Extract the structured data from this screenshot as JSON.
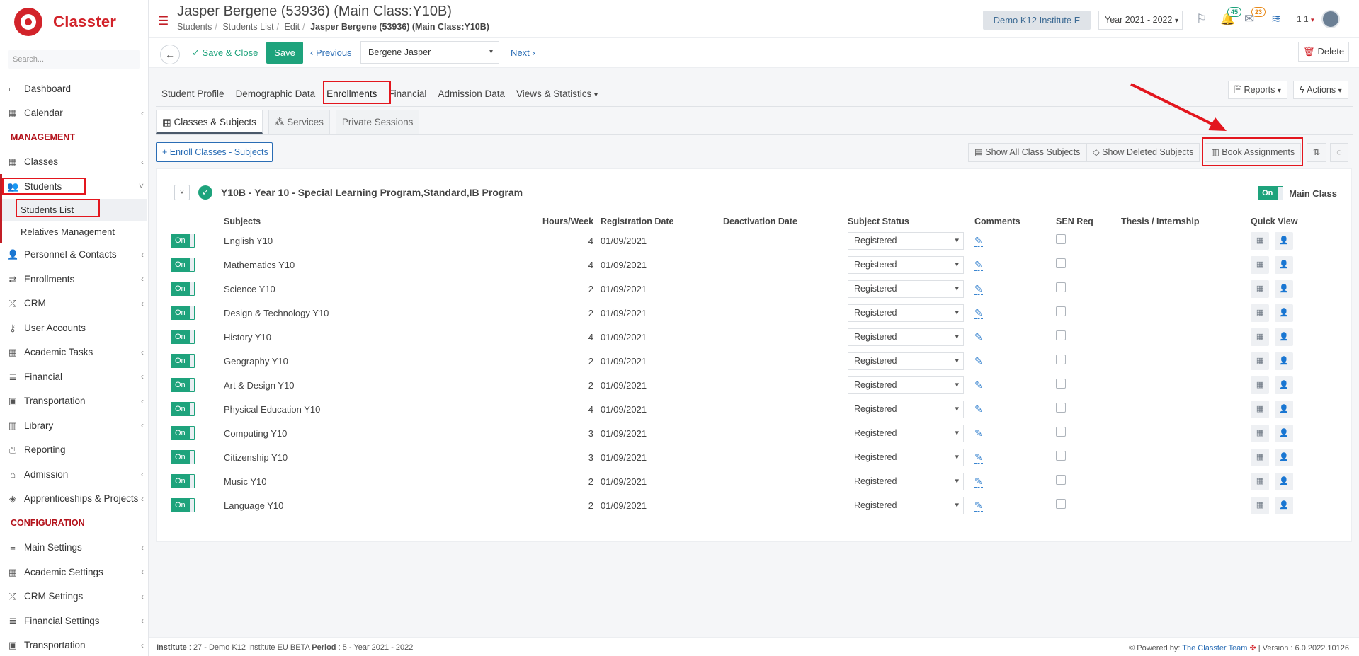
{
  "brand": {
    "name": "Classter",
    "red": "#d2232a",
    "green": "#1ea37c"
  },
  "sidebar": {
    "search_placeholder": "Search...",
    "items_top": [
      {
        "label": "Dashboard",
        "icon": "monitor-icon"
      },
      {
        "label": "Calendar",
        "icon": "calendar-icon"
      }
    ],
    "section_management": "MANAGEMENT",
    "classes": "Classes",
    "students": "Students",
    "students_list": "Students List",
    "relatives": "Relatives Management",
    "items_mgmt": [
      {
        "label": "Personnel & Contacts",
        "icon": "person-icon"
      },
      {
        "label": "Enrollments",
        "icon": "swap-icon"
      },
      {
        "label": "CRM",
        "icon": "crm-icon"
      },
      {
        "label": "User Accounts",
        "icon": "key-icon"
      },
      {
        "label": "Academic Tasks",
        "icon": "grid-icon"
      },
      {
        "label": "Financial",
        "icon": "coins-icon"
      },
      {
        "label": "Transportation",
        "icon": "bus-icon"
      },
      {
        "label": "Library",
        "icon": "books-icon"
      },
      {
        "label": "Reporting",
        "icon": "printer-icon"
      },
      {
        "label": "Admission",
        "icon": "bank-icon"
      },
      {
        "label": "Apprenticeships & Projects",
        "icon": "box-icon"
      }
    ],
    "section_configuration": "CONFIGURATION",
    "items_config": [
      {
        "label": "Main Settings",
        "icon": "sliders-icon"
      },
      {
        "label": "Academic Settings",
        "icon": "classes-icon"
      },
      {
        "label": "CRM Settings",
        "icon": "crm-icon"
      },
      {
        "label": "Financial Settings",
        "icon": "coins-icon"
      },
      {
        "label": "Transportation",
        "icon": "bus-icon"
      }
    ]
  },
  "header": {
    "title": "Jasper Bergene (53936) (Main Class:Y10B)",
    "crumb1": "Students",
    "crumb2": "Students List",
    "crumb3": "Edit",
    "crumb4": "Jasper Bergene (53936) (Main Class:Y10B)",
    "institute": "Demo K12 Institute E",
    "year": "Year 2021 - 2022",
    "badge_notifications": "45",
    "badge_messages": "23",
    "user_num": "1 1"
  },
  "toolbar": {
    "save_close": "Save & Close",
    "save": "Save",
    "previous": "Previous",
    "student": "Bergene Jasper",
    "next": "Next",
    "delete": "Delete"
  },
  "tabs": [
    "Student Profile",
    "Demographic Data",
    "Enrollments",
    "Financial",
    "Admission Data",
    "Views & Statistics"
  ],
  "reports": "Reports",
  "actions": "Actions",
  "subtabs": [
    "Classes & Subjects",
    "Services",
    "Private Sessions"
  ],
  "buttons": {
    "enroll": "Enroll Classes - Subjects",
    "show_all": "Show All Class Subjects",
    "show_deleted": "Show Deleted Subjects",
    "book": "Book Assignments"
  },
  "panel": {
    "class_title": "Y10B - Year 10 - Special Learning Program,Standard,IB Program",
    "toggle_on": "On",
    "main_class": "Main Class",
    "columns": {
      "subjects": "Subjects",
      "hours": "Hours/Week",
      "reg_date": "Registration Date",
      "deact_date": "Deactivation Date",
      "status": "Subject Status",
      "comments": "Comments",
      "sen": "SEN Req",
      "thesis": "Thesis / Internship",
      "quick": "Quick View"
    },
    "rows": [
      {
        "on": "On",
        "subject": "English Y10",
        "hours": "4",
        "date": "01/09/2021",
        "status": "Registered"
      },
      {
        "on": "On",
        "subject": "Mathematics Y10",
        "hours": "4",
        "date": "01/09/2021",
        "status": "Registered"
      },
      {
        "on": "On",
        "subject": "Science Y10",
        "hours": "2",
        "date": "01/09/2021",
        "status": "Registered"
      },
      {
        "on": "On",
        "subject": "Design & Technology Y10",
        "hours": "2",
        "date": "01/09/2021",
        "status": "Registered"
      },
      {
        "on": "On",
        "subject": "History Y10",
        "hours": "4",
        "date": "01/09/2021",
        "status": "Registered"
      },
      {
        "on": "On",
        "subject": "Geography Y10",
        "hours": "2",
        "date": "01/09/2021",
        "status": "Registered"
      },
      {
        "on": "On",
        "subject": "Art & Design Y10",
        "hours": "2",
        "date": "01/09/2021",
        "status": "Registered"
      },
      {
        "on": "On",
        "subject": "Physical Education Y10",
        "hours": "4",
        "date": "01/09/2021",
        "status": "Registered"
      },
      {
        "on": "On",
        "subject": "Computing Y10",
        "hours": "3",
        "date": "01/09/2021",
        "status": "Registered"
      },
      {
        "on": "On",
        "subject": "Citizenship Y10",
        "hours": "3",
        "date": "01/09/2021",
        "status": "Registered"
      },
      {
        "on": "On",
        "subject": "Music Y10",
        "hours": "2",
        "date": "01/09/2021",
        "status": "Registered"
      },
      {
        "on": "On",
        "subject": "Language Y10",
        "hours": "2",
        "date": "01/09/2021",
        "status": "Registered"
      }
    ]
  },
  "footer": {
    "institute_label": "Institute",
    "institute_value": ": 27 - Demo K12 Institute EU BETA",
    "period_label": "Period",
    "period_value": ": 5 - Year 2021 - 2022",
    "powered": "Powered by:",
    "team": "The Classter Team",
    "version": "| Version : 6.0.2022.10126"
  }
}
